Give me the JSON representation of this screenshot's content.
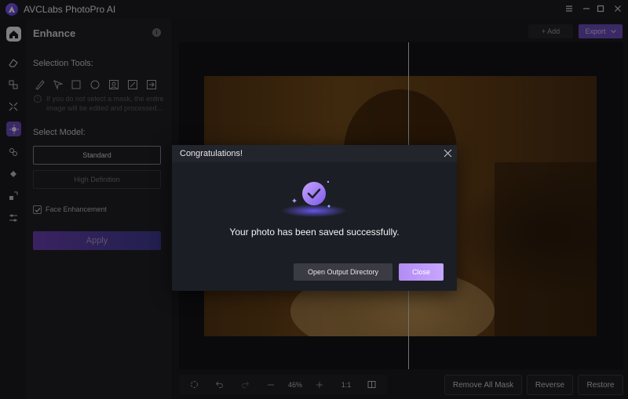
{
  "app": {
    "title": "AVCLabs PhotoPro AI"
  },
  "window": {
    "menu_icon": "menu-icon",
    "minimize_icon": "minimize-icon",
    "maximize_icon": "maximize-icon",
    "close_icon": "close-icon"
  },
  "panel": {
    "title": "Enhance",
    "selection_tools_label": "Selection Tools:",
    "hint": "If you do not select a mask, the entire image will be edited and processed...",
    "hint_line1": "If you do not select a mask, the entire",
    "hint_line2": "image will be edited and processed...",
    "select_model_label": "Select Model:",
    "model_standard": "Standard",
    "model_hd": "High Definition",
    "face_enhancement": "Face Enhancement",
    "face_enhancement_checked": true,
    "apply": "Apply"
  },
  "toolbar": {
    "add": "+ Add",
    "export": "Export"
  },
  "bottom": {
    "zoom": "46%",
    "ratio": "1:1",
    "remove_all_mask": "Remove All Mask",
    "reverse": "Reverse",
    "restore": "Restore"
  },
  "dialog": {
    "title": "Congratulations!",
    "message": "Your photo has been saved successfully.",
    "open_output": "Open Output Directory",
    "close": "Close"
  },
  "colors": {
    "accent": "#7c5cf0",
    "apply_gradient_start": "#6b3fb0",
    "apply_gradient_end": "#3e3a8f"
  }
}
